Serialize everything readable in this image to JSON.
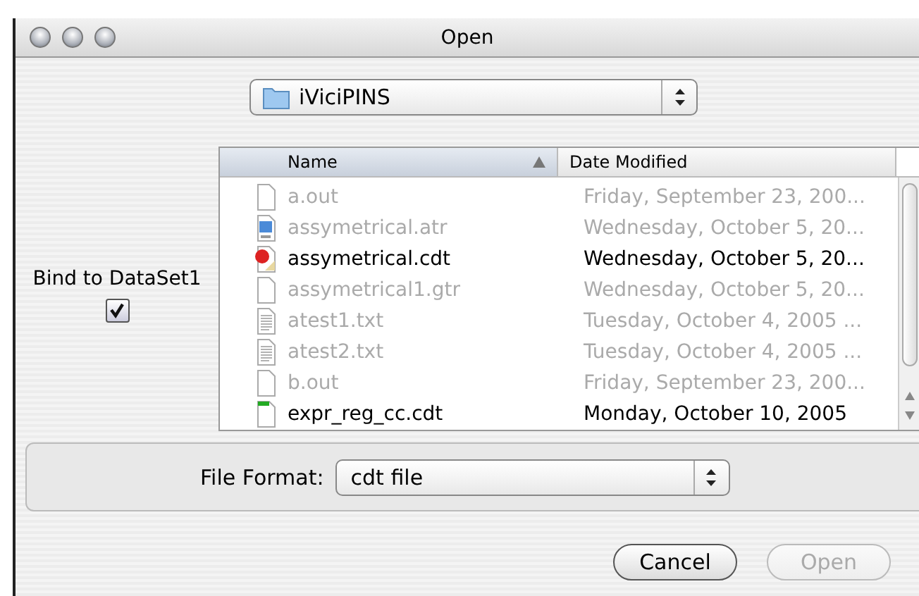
{
  "window": {
    "title": "Open"
  },
  "folder_popup": {
    "value": "iViciPINS"
  },
  "bind_option": {
    "label": "Bind to DataSet1",
    "checked": true
  },
  "file_list": {
    "columns": [
      {
        "label": "Name",
        "sorted": true
      },
      {
        "label": "Date Modified",
        "sorted": false
      }
    ],
    "rows": [
      {
        "name": "a.out",
        "date": "Friday, September 23, 200...",
        "kind": "blank",
        "disabled": true
      },
      {
        "name": "assymetrical.atr",
        "date": "Wednesday, October 5, 20...",
        "kind": "app",
        "disabled": true
      },
      {
        "name": "assymetrical.cdt",
        "date": "Wednesday, October 5, 20...",
        "kind": "chart",
        "disabled": false
      },
      {
        "name": "assymetrical1.gtr",
        "date": "Wednesday, October 5, 20...",
        "kind": "blank",
        "disabled": true
      },
      {
        "name": "atest1.txt",
        "date": "Tuesday, October 4, 2005 ...",
        "kind": "text",
        "disabled": true
      },
      {
        "name": "atest2.txt",
        "date": "Tuesday, October 4, 2005 ...",
        "kind": "text",
        "disabled": true
      },
      {
        "name": "b.out",
        "date": "Friday, September 23, 200...",
        "kind": "blank",
        "disabled": true
      },
      {
        "name": "expr_reg_cc.cdt",
        "date": "Monday, October 10, 2005",
        "kind": "tagged",
        "disabled": false
      }
    ]
  },
  "file_format": {
    "label": "File Format:",
    "value": "cdt file"
  },
  "buttons": [
    {
      "label": "Cancel",
      "disabled": false
    },
    {
      "label": "Open",
      "disabled": true
    }
  ]
}
